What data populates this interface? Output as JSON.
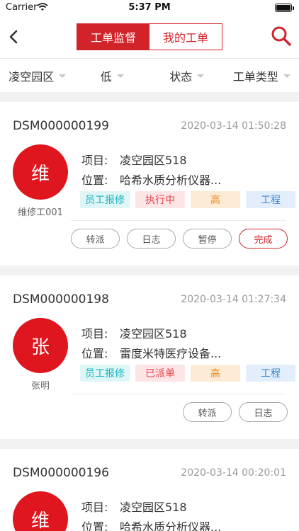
{
  "status_bar": {
    "carrier": "Carrier",
    "time": "5:37 PM"
  },
  "nav": {
    "tabs": [
      {
        "label": "工单监督",
        "active": true
      },
      {
        "label": "我的工单",
        "active": false
      }
    ]
  },
  "filters": [
    "凌空园区",
    "低",
    "状态",
    "工单类型"
  ],
  "orders": [
    {
      "number": "DSM000000199",
      "time": "2020-03-14 01:50:28",
      "avatar_char": "维",
      "assignee": "维修工001",
      "project_label": "项目:",
      "project": "凌空园区518",
      "location_label": "位置:",
      "location": "哈希水质分析仪器...",
      "tags": [
        "员工报修",
        "执行中",
        "高",
        "工程"
      ],
      "actions": [
        "转派",
        "日志",
        "暂停",
        "完成"
      ]
    },
    {
      "number": "DSM000000198",
      "time": "2020-03-14 01:27:34",
      "avatar_char": "张",
      "assignee": "张明",
      "project_label": "项目:",
      "project": "凌空园区518",
      "location_label": "位置:",
      "location": "雷度米特医疗设备...",
      "tags": [
        "员工报修",
        "已派单",
        "高",
        "工程"
      ],
      "actions": [
        "转派",
        "日志"
      ]
    },
    {
      "number": "DSM000000196",
      "time": "2020-03-14 00:20:01",
      "avatar_char": "维",
      "assignee": "",
      "project_label": "项目:",
      "project": "凌空园区518",
      "location_label": "位置:",
      "location": "哈希水质分析仪器...",
      "tags": [],
      "actions": []
    }
  ],
  "colors": {
    "accent": "#d2232a",
    "avatar": "#e0161e"
  }
}
